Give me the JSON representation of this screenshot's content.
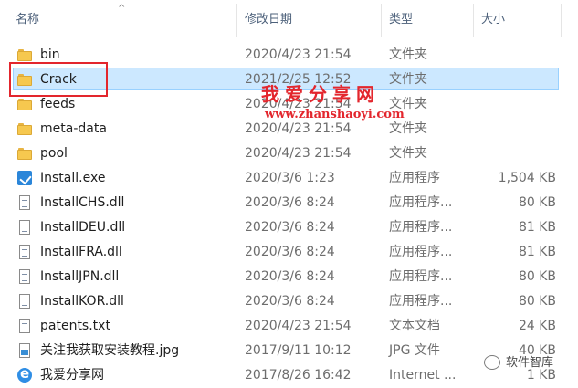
{
  "header": {
    "name": "名称",
    "date": "修改日期",
    "type": "类型",
    "size": "大小",
    "sort_indicator": "^"
  },
  "rows": [
    {
      "name": "bin",
      "date": "2020/4/23 21:54",
      "type": "文件夹",
      "size": "",
      "icon": "folder-icon"
    },
    {
      "name": "Crack",
      "date": "2021/2/25 12:52",
      "type": "文件夹",
      "size": "",
      "icon": "folder-icon",
      "selected": true
    },
    {
      "name": "feeds",
      "date": "2020/4/23 21:54",
      "type": "文件夹",
      "size": "",
      "icon": "folder-icon"
    },
    {
      "name": "meta-data",
      "date": "2020/4/23 21:54",
      "type": "文件夹",
      "size": "",
      "icon": "folder-icon"
    },
    {
      "name": "pool",
      "date": "2020/4/23 21:54",
      "type": "文件夹",
      "size": "",
      "icon": "folder-icon"
    },
    {
      "name": "Install.exe",
      "date": "2020/3/6 1:23",
      "type": "应用程序",
      "size": "1,504 KB",
      "icon": "installer-icon"
    },
    {
      "name": "InstallCHS.dll",
      "date": "2020/3/6 8:24",
      "type": "应用程序...",
      "size": "80 KB",
      "icon": "dll-file-icon"
    },
    {
      "name": "InstallDEU.dll",
      "date": "2020/3/6 8:24",
      "type": "应用程序...",
      "size": "81 KB",
      "icon": "dll-file-icon"
    },
    {
      "name": "InstallFRA.dll",
      "date": "2020/3/6 8:24",
      "type": "应用程序...",
      "size": "81 KB",
      "icon": "dll-file-icon"
    },
    {
      "name": "InstallJPN.dll",
      "date": "2020/3/6 8:24",
      "type": "应用程序...",
      "size": "80 KB",
      "icon": "dll-file-icon"
    },
    {
      "name": "InstallKOR.dll",
      "date": "2020/3/6 8:24",
      "type": "应用程序...",
      "size": "80 KB",
      "icon": "dll-file-icon"
    },
    {
      "name": "patents.txt",
      "date": "2020/4/23 21:54",
      "type": "文本文档",
      "size": "24 KB",
      "icon": "text-file-icon"
    },
    {
      "name": "关注我获取安装教程.jpg",
      "date": "2017/9/11 10:12",
      "type": "JPG 文件",
      "size": "40 KB",
      "icon": "image-file-icon"
    },
    {
      "name": "我爱分享网",
      "date": "2017/8/26 16:42",
      "type": "Internet ...",
      "size": "1 KB",
      "icon": "internet-shortcut-icon"
    }
  ],
  "watermark": {
    "title": "我爱分享网",
    "url": "www.zhanshaoyi.com"
  },
  "brand": {
    "text": "软件智库",
    "icon": "wechat-icon"
  },
  "colors": {
    "selection_bg": "#cce8ff",
    "selection_border": "#99d1ff",
    "highlight_red": "#e3262d",
    "folder_yellow": "#f6c84f"
  }
}
